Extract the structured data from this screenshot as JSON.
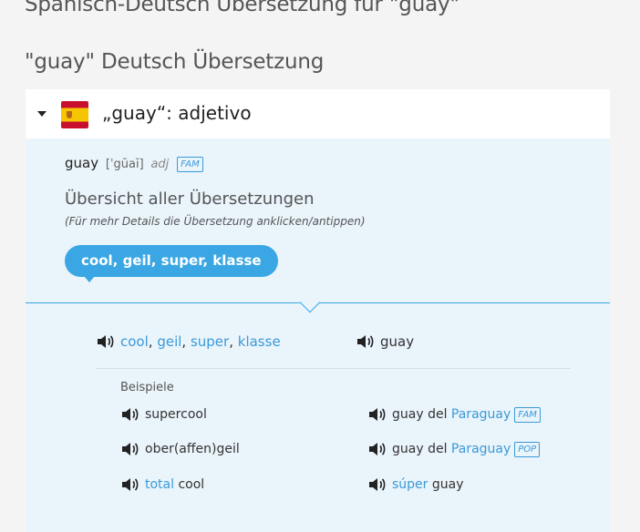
{
  "page": {
    "heading": "Spanisch-Deutsch Übersetzung für \"guay\"",
    "section_heading": "\"guay\" Deutsch Übersetzung"
  },
  "entry": {
    "title": "„guay“: adjetivo",
    "flag_icon": "spain-flag-icon",
    "headword": "guay",
    "phonetic": "[ˈgŭaĭ]",
    "pos": "adj",
    "register_tag": "FAM",
    "overview_title": "Übersicht aller Übersetzungen",
    "overview_note": "(Für mehr Details die Übersetzung anklicken/antippen)",
    "summary_pill": "cool, geil, super, klasse",
    "main_translation": {
      "targets": [
        "cool",
        "geil",
        "super",
        "klasse"
      ],
      "separator": ", ",
      "source": "guay"
    },
    "examples_label": "Beispiele",
    "examples": [
      {
        "left": {
          "parts": [
            {
              "text": "supercool",
              "link": false
            }
          ]
        },
        "right": {
          "parts": [
            {
              "text": "guay del ",
              "link": false
            },
            {
              "text": "Paraguay",
              "link": true
            }
          ],
          "tag": "FAM"
        }
      },
      {
        "left": {
          "parts": [
            {
              "text": "ober(affen)geil",
              "link": false
            }
          ]
        },
        "right": {
          "parts": [
            {
              "text": "guay del ",
              "link": false
            },
            {
              "text": "Paraguay",
              "link": true
            }
          ],
          "tag": "POP"
        }
      },
      {
        "left": {
          "parts": [
            {
              "text": "total",
              "link": true
            },
            {
              "text": " cool",
              "link": false
            }
          ]
        },
        "right": {
          "parts": [
            {
              "text": "súper",
              "link": true
            },
            {
              "text": " guay",
              "link": false
            }
          ],
          "tag": ""
        }
      }
    ]
  },
  "colors": {
    "accent": "#3aa7e4",
    "link": "#3a9ad9",
    "body_bg": "#eaf4fb"
  }
}
